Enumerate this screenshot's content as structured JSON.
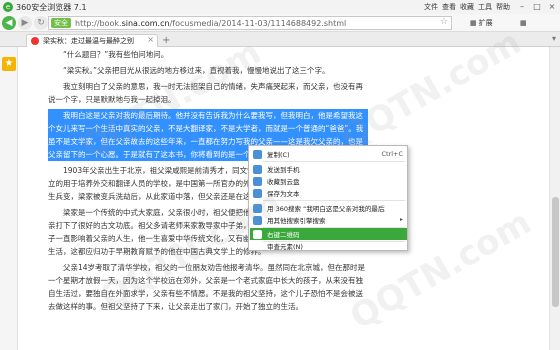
{
  "window": {
    "title": "360安全浏览器 7.1",
    "menus": [
      "文件",
      "查看",
      "收藏",
      "工具",
      "帮助"
    ],
    "controls": [
      "–",
      "□",
      "×"
    ]
  },
  "nav": {
    "back": "◀",
    "forward": "▶",
    "refresh": "↻",
    "safe_badge": "安全",
    "url_prefix": "http://book.",
    "url_domain": "sina.com.cn",
    "url_path": "/focusmedia/2014-11-03/1114688492.shtml",
    "ext_label": "扩展",
    "grid_label": "▦"
  },
  "tab": {
    "title": "梁实秋：走过最温与最醉之别",
    "close": "×",
    "new": "+",
    "menu": "▾"
  },
  "sidebar": {
    "fav": "★"
  },
  "content": {
    "paragraphs": [
      "“什么题目？”我有些怕问地问。",
      "“梁实秋。”父亲把目光从很远的地方移过来，直视着我，慢慢地说出了这三个字。",
      "我立刻明白了父亲的意思，我一时无法招架自己的情绪，失声痛哭起来，而父亲，也没有再说一个字，只是默默地与我一起掉泪。",
      "我明白这是父亲对我的最后期待。他并没有告诉我为什么要我写，但我明白，他是希望我这个女儿来写一个生活中真实的父亲，不是大翻译家，不是大学者，而就是一个普通的“爸爸”。我虽不是文学家，但在父亲故去的这些年来，一直都在努力写我的父亲——这是我欠父亲的，也是父亲留下的一个心愿。于是就有了这本书，你将看到的是一个真实的、有血有肉的父亲。",
      "1903年父亲出生于北京，祖父梁咸熙是前清秀才，同文馆英文班第一期学生，当时在北京设立的用于培养外交和翻译人员的学校，是中国第一所官办的外语学校。我的父亲1912年，北京发生兵变，梁家被变兵洗劫后，从此家道中落，但父亲还是在这个书香门第的家中，读书成长。",
      "梁家是一个传统的中式大家庭，父亲很小时，祖父便把他送进私塾，他那时背诵诗文，为父亲打下了很好的古文功底。祖父多请老师来家教导家中子弟，教授《四书》等经典，我想那段日子一直影响着父亲的人生，他一生喜爱中华传统文化，又有幽默的气度，用英文写作，用白话文生活，这都应归功于早期教育赋予的他在中国古典文学上的修养。",
      "父亲14岁考取了清华学校，祖父的一位朋友劝告他报考清华。虽然同在北京城，但在那时是一个星期才放假一天，因为这个学校远在郊外，父亲是一个老式家庭中长大的孩子，从来没有独自生活过，要独自在外面求学，父亲有些不情愿。不是我的祖父坚持，这个儿子恐怕不是会被送去做这样的事。但祖父坚持了下来，让父亲走出了家门，开始了独立的生活。"
    ],
    "selected_index": 3
  },
  "context_menu": {
    "items": [
      {
        "label": "复制(C)",
        "shortcut": "Ctrl+C",
        "arrow": "",
        "highlight": false
      },
      {
        "label": "发送到手机",
        "shortcut": "",
        "arrow": "",
        "highlight": false
      },
      {
        "label": "收藏到云盘",
        "shortcut": "",
        "arrow": "",
        "highlight": false
      },
      {
        "label": "保存为文本",
        "shortcut": "",
        "arrow": "",
        "highlight": false
      },
      {
        "label": "用 360搜索 “我明白这是父亲对我的最后期待…”",
        "shortcut": "",
        "arrow": "",
        "highlight": false
      },
      {
        "label": "用其他搜索引擎搜索",
        "shortcut": "",
        "arrow": "▸",
        "highlight": false
      },
      {
        "label": "右键二维码",
        "shortcut": "",
        "arrow": "",
        "highlight": true
      },
      {
        "label": "审查元素(N)",
        "shortcut": "",
        "arrow": "",
        "highlight": false
      }
    ]
  },
  "watermark": "QQTN.com",
  "colors": {
    "accent_green": "#3aa83a",
    "selection_blue": "#3390ff"
  }
}
